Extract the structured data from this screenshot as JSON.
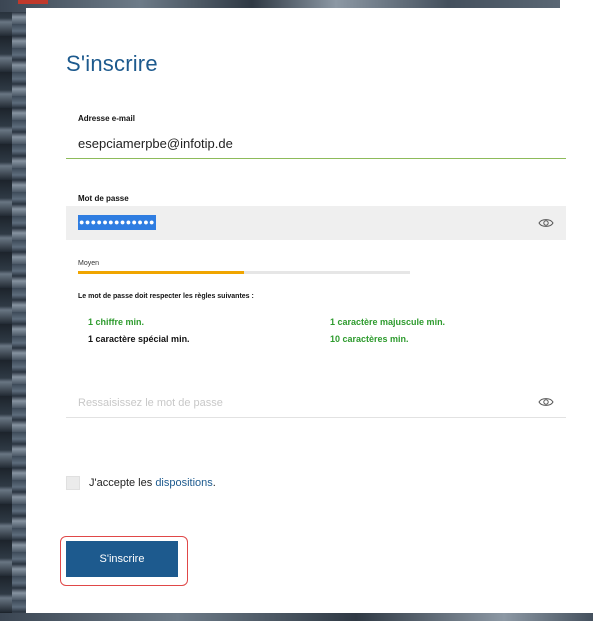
{
  "form": {
    "title": "S'inscrire",
    "email": {
      "label": "Adresse e-mail",
      "value": "esepciamerpbe@infotip.de"
    },
    "password": {
      "label": "Mot de passe",
      "masked_value": "●●●●●●●●●●●●●",
      "strength_label": "Moyen",
      "strength_fraction": 0.5,
      "strength_color": "#f0a500"
    },
    "rules": {
      "title": "Le mot de passe doit respecter les règles suivantes :",
      "items": [
        {
          "label": "1 chiffre min.",
          "satisfied": true
        },
        {
          "label": "1 caractère majuscule min.",
          "satisfied": true
        },
        {
          "label": "1 caractère spécial min.",
          "satisfied": false
        },
        {
          "label": "10 caractères min.",
          "satisfied": true
        }
      ]
    },
    "confirm_password": {
      "placeholder": "Ressaisissez le mot de passe",
      "value": ""
    },
    "terms": {
      "prefix": "J'accepte les ",
      "link_text": "dispositions",
      "suffix": ".",
      "checked": false
    },
    "submit_label": "S'inscrire"
  },
  "colors": {
    "primary": "#1d5a8e",
    "rule_ok": "#2e9b2e",
    "highlight_border": "#e04848",
    "email_underline": "#8dbb5a"
  },
  "icons": {
    "show_password": "eye-icon"
  }
}
